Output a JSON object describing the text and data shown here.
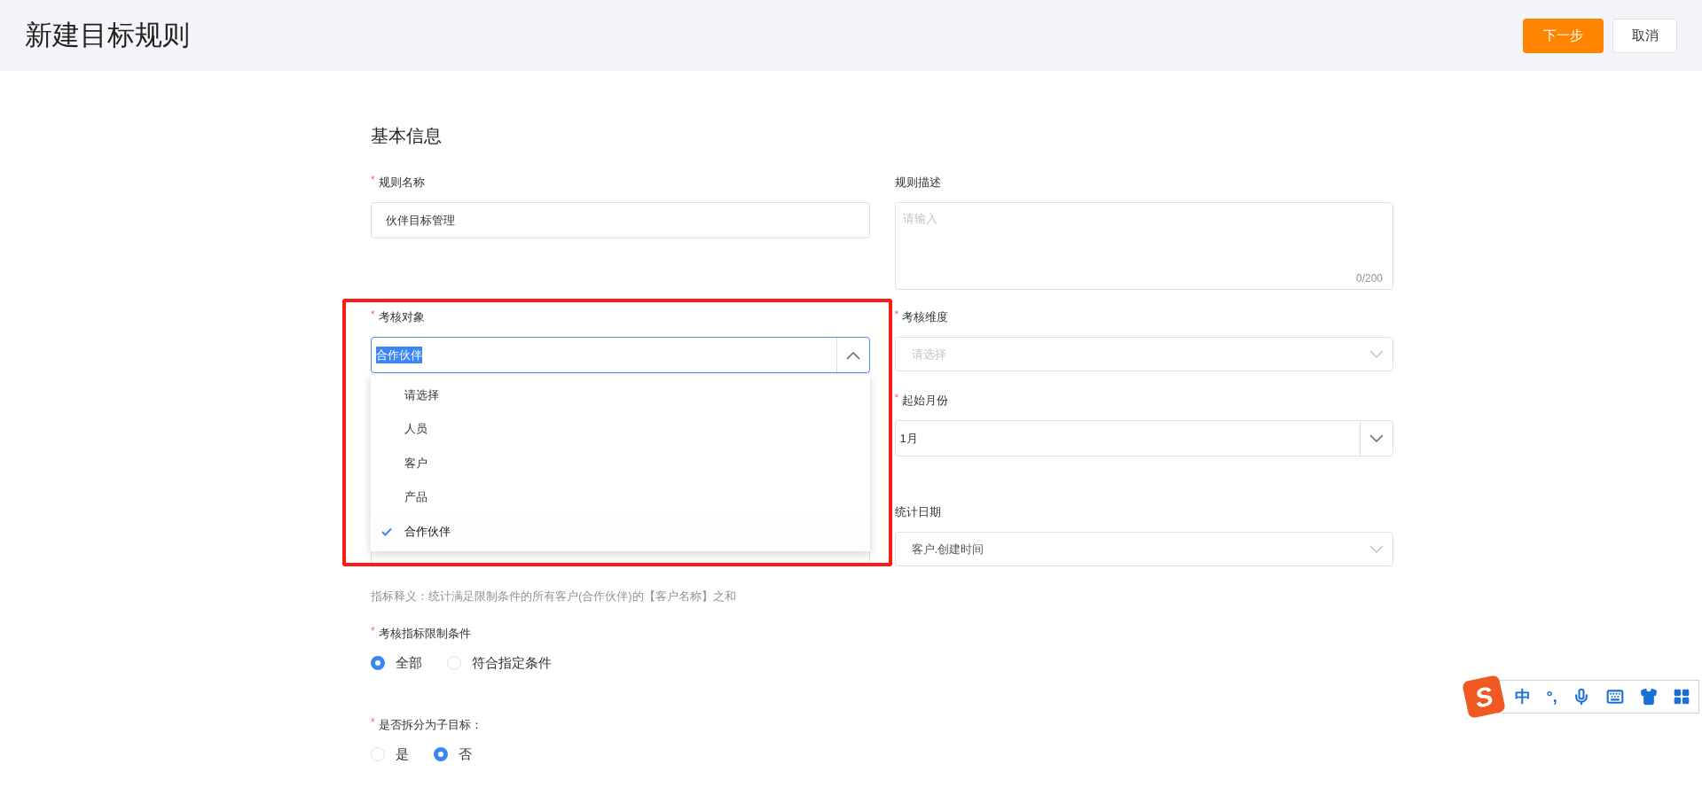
{
  "header": {
    "title": "新建目标规则",
    "buttons": [
      {
        "label": "下一步",
        "kind": "primary"
      },
      {
        "label": "取消",
        "kind": "default"
      }
    ]
  },
  "section_title": "基本信息",
  "rows": [
    [
      {
        "kind": "text",
        "label": "规则名称",
        "required_mark": "*",
        "value": "伙伴目标管理"
      },
      {
        "kind": "textarea",
        "label": "规则描述",
        "placeholder": "请输入",
        "counter": "0/200"
      }
    ],
    [
      {
        "kind": "split-select",
        "label": "考核对象",
        "required_mark": "*",
        "value": "合作伙伴",
        "highlighted": true,
        "expanded": true,
        "options": [
          {
            "label": "请选择",
            "selected": false
          },
          {
            "label": "人员",
            "selected": false
          },
          {
            "label": "客户",
            "selected": false
          },
          {
            "label": "产品",
            "selected": false
          },
          {
            "label": "合作伙伴",
            "selected": true
          }
        ]
      },
      {
        "kind": "select",
        "label": "考核维度",
        "required_mark": "*",
        "placeholder": "请选择"
      }
    ],
    [
      {
        "kind": "empty"
      },
      {
        "kind": "split-select",
        "label": "起始月份",
        "required_mark": "*",
        "value": "1月",
        "highlighted": false,
        "expanded": false
      }
    ],
    [
      {
        "kind": "select"
      },
      {
        "kind": "select",
        "label": "统计日期",
        "value": "客户.创建时间"
      }
    ]
  ],
  "definition": "指标释义：统计满足限制条件的所有客户(合作伙伴)的【客户名称】之和",
  "radio_groups": [
    {
      "label": "考核指标限制条件",
      "required_mark": "*",
      "options": [
        {
          "label": "全部",
          "selected": true
        },
        {
          "label": "符合指定条件",
          "selected": false
        }
      ]
    },
    {
      "label": "是否拆分为子目标：",
      "required_mark": "*",
      "options": [
        {
          "label": "是",
          "selected": false
        },
        {
          "label": "否",
          "selected": true
        }
      ]
    }
  ],
  "ime_toolbar": {
    "logo": "S",
    "items": [
      {
        "kind": "text",
        "label": "中"
      },
      {
        "kind": "text",
        "label": "°,"
      },
      {
        "kind": "mic"
      },
      {
        "kind": "keyboard"
      },
      {
        "kind": "shirt"
      },
      {
        "kind": "grid"
      }
    ]
  }
}
